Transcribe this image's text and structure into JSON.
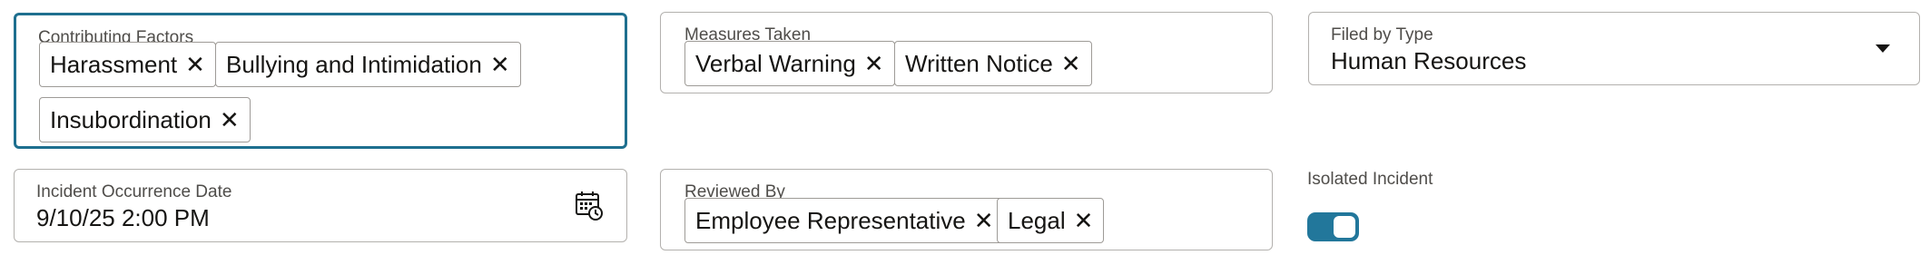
{
  "contributing_factors": {
    "label": "Contributing Factors",
    "chips": [
      "Harassment",
      "Bullying and Intimidation",
      "Insubordination"
    ]
  },
  "measures_taken": {
    "label": "Measures Taken",
    "chips": [
      "Verbal Warning",
      "Written Notice"
    ]
  },
  "filed_by_type": {
    "label": "Filed by Type",
    "value": "Human Resources"
  },
  "incident_occurrence_date": {
    "label": "Incident Occurrence Date",
    "value": "9/10/25 2:00 PM"
  },
  "reviewed_by": {
    "label": "Reviewed By",
    "chips": [
      "Employee Representative",
      "Legal"
    ]
  },
  "isolated_incident": {
    "label": "Isolated Incident",
    "checked": true
  },
  "icons": {
    "remove": "close-icon",
    "dropdown": "chevron-down-icon",
    "calendar": "calendar-icon"
  },
  "colors": {
    "focus_border": "#1e6f8f",
    "toggle_on": "#22779b"
  }
}
